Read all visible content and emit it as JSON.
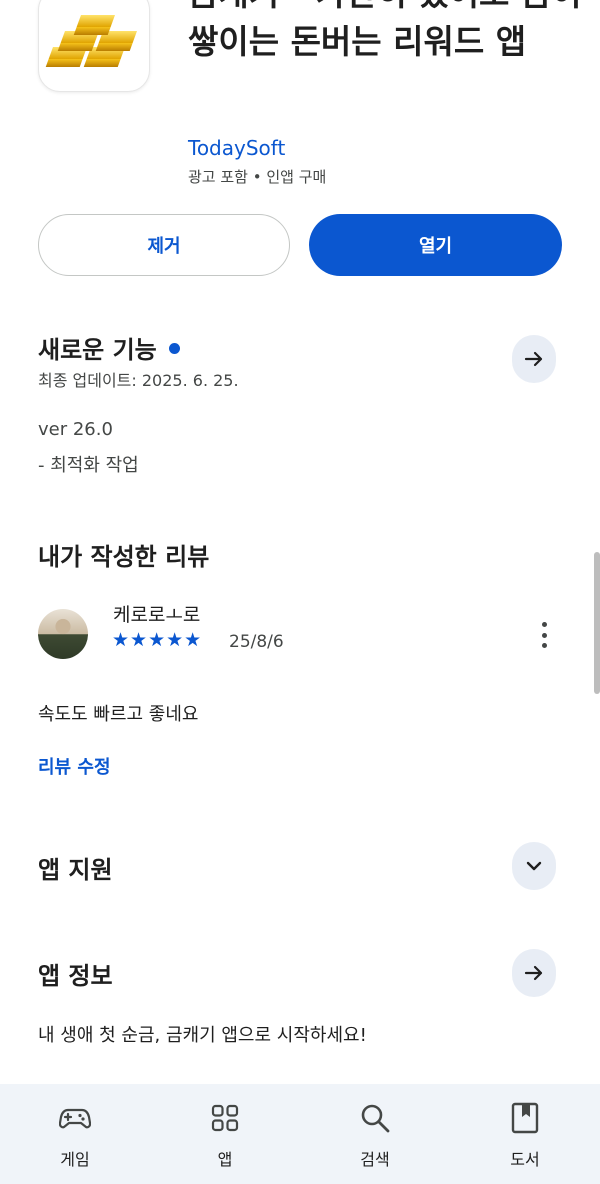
{
  "app": {
    "title": "금캐기 - 가만히 있어도 금이 쌓이는 돈버는 리워드 앱",
    "developer": "TodaySoft",
    "ad_info": "광고 포함 • 인앱 구매",
    "icon": "gold-bars-icon"
  },
  "actions": {
    "remove_label": "제거",
    "open_label": "열기"
  },
  "whats_new": {
    "title": "새로운 기능",
    "last_updated": "최종 업데이트: 2025. 6. 25.",
    "version": "ver 26.0",
    "notes": "- 최적화 작업"
  },
  "my_review": {
    "title": "내가 작성한 리뷰",
    "reviewer": "케로로ㅗ로",
    "rating": 5,
    "stars": "★★★★★",
    "date": "25/8/6",
    "text": "속도도 빠르고 좋네요",
    "edit_label": "리뷰 수정"
  },
  "app_support": {
    "title": "앱 지원"
  },
  "app_info": {
    "title": "앱 정보",
    "description": "내 생애 첫 순금, 금캐기 앱으로 시작하세요!"
  },
  "bottom_nav": {
    "games": "게임",
    "apps": "앱",
    "search": "검색",
    "books": "도서"
  },
  "colors": {
    "accent": "#0b57d0",
    "round_button_bg": "#e8edf5",
    "nav_bg": "#f0f4f9"
  }
}
